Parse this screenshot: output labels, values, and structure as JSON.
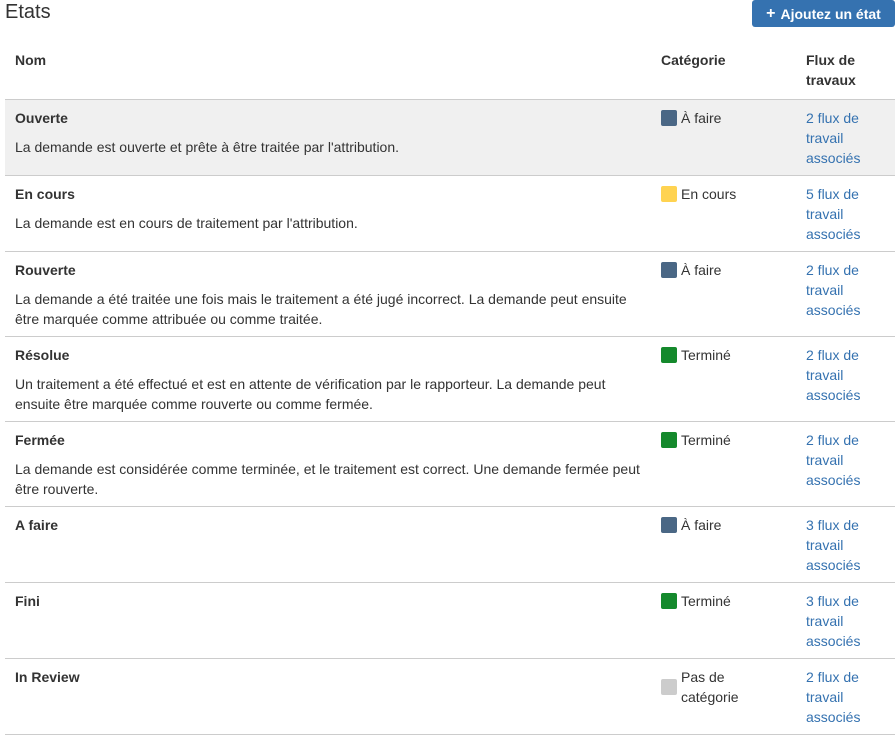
{
  "header": {
    "title": "Etats",
    "add_button_label": "Ajoutez un état",
    "add_button_icon": "plus-icon"
  },
  "table": {
    "columns": [
      "Nom",
      "Catégorie",
      "Flux de travaux"
    ],
    "rows": [
      {
        "name": "Ouverte",
        "description": "La demande est ouverte et prête à être traitée par l'attribution.",
        "category": "À faire",
        "category_color": "#4a6785",
        "workflows": "2 flux de travail associés"
      },
      {
        "name": "En cours",
        "description": "La demande est en cours de traitement par l'attribution.",
        "category": "En cours",
        "category_color": "#ffd351",
        "workflows": "5 flux de travail associés"
      },
      {
        "name": "Rouverte",
        "description": "La demande a été traitée une fois mais le traitement a été jugé incorrect. La demande peut ensuite être marquée comme attribuée ou comme traitée.",
        "category": "À faire",
        "category_color": "#4a6785",
        "workflows": "2 flux de travail associés"
      },
      {
        "name": "Résolue",
        "description": "Un traitement a été effectué et est en attente de vérification par le rapporteur. La demande peut ensuite être marquée comme rouverte ou comme fermée.",
        "category": "Terminé",
        "category_color": "#14892c",
        "workflows": "2 flux de travail associés"
      },
      {
        "name": "Fermée",
        "description": "La demande est considérée comme terminée, et le traitement est correct. Une demande fermée peut être rouverte.",
        "category": "Terminé",
        "category_color": "#14892c",
        "workflows": "2 flux de travail associés"
      },
      {
        "name": "A faire",
        "description": "",
        "category": "À faire",
        "category_color": "#4a6785",
        "workflows": "3 flux de travail associés"
      },
      {
        "name": "Fini",
        "description": "",
        "category": "Terminé",
        "category_color": "#14892c",
        "workflows": "3 flux de travail associés"
      },
      {
        "name": "In Review",
        "description": "",
        "category": "Pas de catégorie",
        "category_color": "#cccccc",
        "workflows": "2 flux de travail associés"
      }
    ]
  }
}
